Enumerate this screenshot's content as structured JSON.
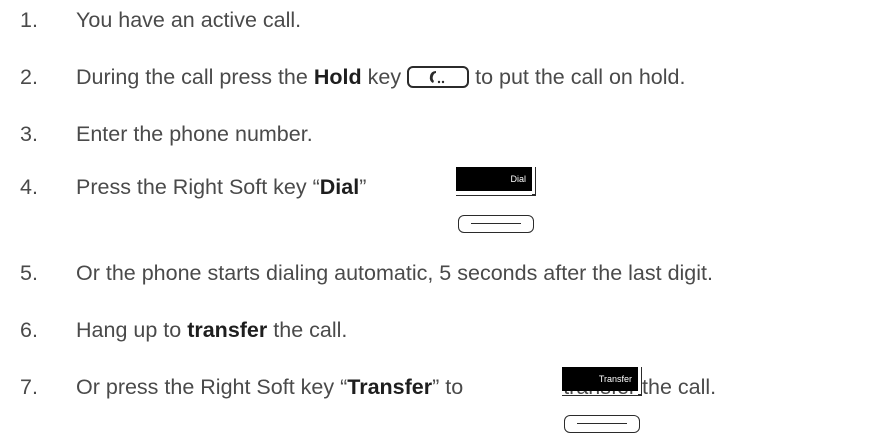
{
  "steps": [
    {
      "num": "1.",
      "text": "You have an active call."
    },
    {
      "num": "2.",
      "pre": "During the call press the",
      "bold": "Hold",
      "mid": "key",
      "post": "to put the call on hold."
    },
    {
      "num": "3.",
      "text": "Enter the phone number."
    },
    {
      "num": "4.",
      "pre": "Press the Right Soft key “",
      "bold": "Dial",
      "post": "”"
    },
    {
      "num": "5.",
      "text": "Or the phone starts dialing automatic, 5 seconds after the last digit."
    },
    {
      "num": "6.",
      "pre": "Hang up to",
      "bold": "transfer",
      "post": "the call."
    },
    {
      "num": "7.",
      "pre": "Or press the Right Soft key “",
      "bold": "Transfer",
      "mid": "” to",
      "post": "transfer the call."
    }
  ],
  "softkeys": {
    "dial_label": "Dial",
    "transfer_label": "Transfer"
  },
  "icons": {
    "hold_key": "handset-icon",
    "soft_key": "soft-key-button-icon"
  }
}
